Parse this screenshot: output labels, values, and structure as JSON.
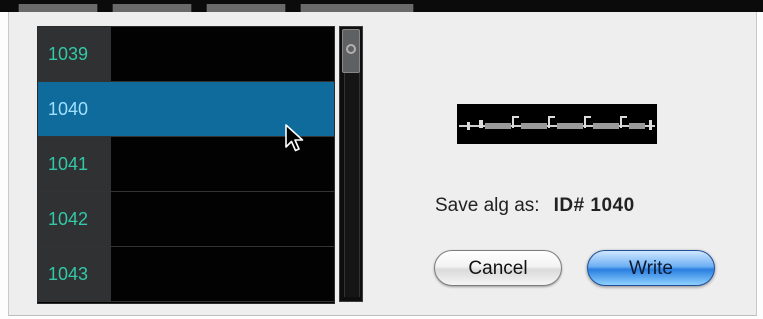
{
  "dialog": {
    "presets": [
      {
        "number": "1039",
        "selected": false
      },
      {
        "number": "1040",
        "selected": true
      },
      {
        "number": "1041",
        "selected": false
      },
      {
        "number": "1042",
        "selected": false
      },
      {
        "number": "1043",
        "selected": false
      }
    ],
    "save_label": "Save alg as:",
    "save_id": "ID# 1040",
    "cancel_label": "Cancel",
    "write_label": "Write"
  },
  "colors": {
    "list_background": "#000000",
    "number_column": "#2f3133",
    "number_text": "#33c8a8",
    "selected_row": "#0f6b9c",
    "write_button": "#2a7fe0"
  },
  "icons": {
    "cursor": "arrow-cursor-icon",
    "scroll_grip": "scroll-grip-icon",
    "algorithm": "algorithm-diagram-icon"
  }
}
